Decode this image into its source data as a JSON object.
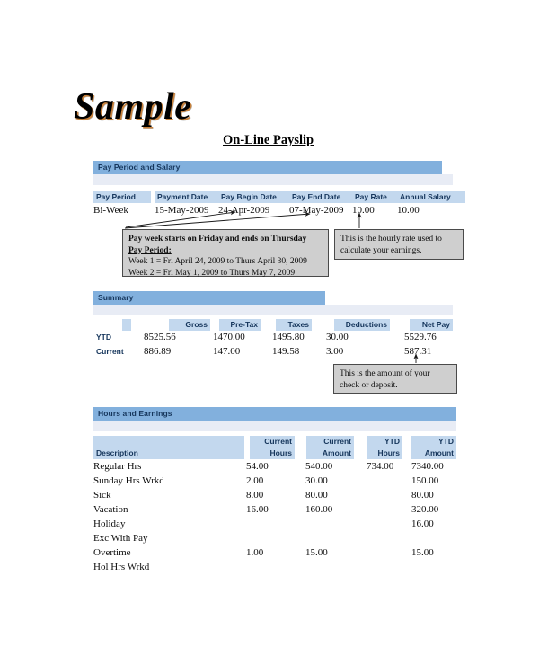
{
  "document": {
    "watermark": "Sample",
    "title": "On-Line Payslip"
  },
  "colors": {
    "section_bar": "#82b0dd",
    "section_sub": "#e8ecf5",
    "table_header": "#c3d8ee",
    "callout_bg": "#cfcfcf",
    "callout_border": "#4a4a4a",
    "header_text": "#16365c"
  },
  "sections": {
    "pay_period": {
      "label": "Pay Period and Salary"
    },
    "summary": {
      "label": "Summary"
    },
    "hours_and_earnings": {
      "label": "Hours and Earnings"
    }
  },
  "pay_period_table": {
    "headers": [
      "Pay Period",
      "Payment Date",
      "Pay Begin Date",
      "Pay End Date",
      "Pay Rate",
      "Annual Salary"
    ],
    "values": [
      "Bi-Week",
      "15-May-2009",
      "24-Apr-2009",
      "07-May-2009",
      "10.00",
      "10.00"
    ]
  },
  "callouts": {
    "pay_week": {
      "line1": "Pay week starts on Friday and ends on Thursday",
      "line2": "Pay Period:",
      "line3": "Week 1 = Fri April 24, 2009 to Thurs April 30, 2009",
      "line4": "Week 2 = Fri May 1, 2009 to Thurs May 7, 2009"
    },
    "hourly_rate": {
      "text": "This is the hourly rate used to calculate your earnings."
    },
    "net_pay": {
      "text": "This is the amount of your check or deposit."
    }
  },
  "summary_table": {
    "headers": [
      "",
      "Gross",
      "Pre-Tax",
      "Taxes",
      "Deductions",
      "Net Pay"
    ],
    "rows": [
      {
        "label": "YTD",
        "gross": "8525.56",
        "pre_tax": "1470.00",
        "taxes": "1495.80",
        "deductions": "30.00",
        "net_pay": "5529.76"
      },
      {
        "label": "Current",
        "gross": "886.89",
        "pre_tax": "147.00",
        "taxes": "149.58",
        "deductions": "3.00",
        "net_pay": "587.31"
      }
    ]
  },
  "earnings_table": {
    "headers": {
      "description": "Description",
      "current_hours_l1": "Current",
      "current_hours_l2": "Hours",
      "current_amount_l1": "Current",
      "current_amount_l2": "Amount",
      "ytd_hours_l1": "YTD",
      "ytd_hours_l2": "Hours",
      "ytd_amount_l1": "YTD",
      "ytd_amount_l2": "Amount"
    },
    "rows": [
      {
        "description": "Regular Hrs",
        "current_hours": "54.00",
        "current_amount": "540.00",
        "ytd_hours": "734.00",
        "ytd_amount": "7340.00"
      },
      {
        "description": "Sunday Hrs Wrkd",
        "current_hours": "2.00",
        "current_amount": "30.00",
        "ytd_hours": "",
        "ytd_amount": "150.00"
      },
      {
        "description": "Sick",
        "current_hours": "8.00",
        "current_amount": "80.00",
        "ytd_hours": "",
        "ytd_amount": "80.00"
      },
      {
        "description": "Vacation",
        "current_hours": "16.00",
        "current_amount": "160.00",
        "ytd_hours": "",
        "ytd_amount": "320.00"
      },
      {
        "description": "Holiday",
        "current_hours": "",
        "current_amount": "",
        "ytd_hours": "",
        "ytd_amount": "16.00"
      },
      {
        "description": "Exc With Pay",
        "current_hours": "",
        "current_amount": "",
        "ytd_hours": "",
        "ytd_amount": ""
      },
      {
        "description": "Overtime",
        "current_hours": "1.00",
        "current_amount": "15.00",
        "ytd_hours": "",
        "ytd_amount": "15.00"
      },
      {
        "description": "Hol Hrs Wrkd",
        "current_hours": "",
        "current_amount": "",
        "ytd_hours": "",
        "ytd_amount": ""
      }
    ]
  }
}
